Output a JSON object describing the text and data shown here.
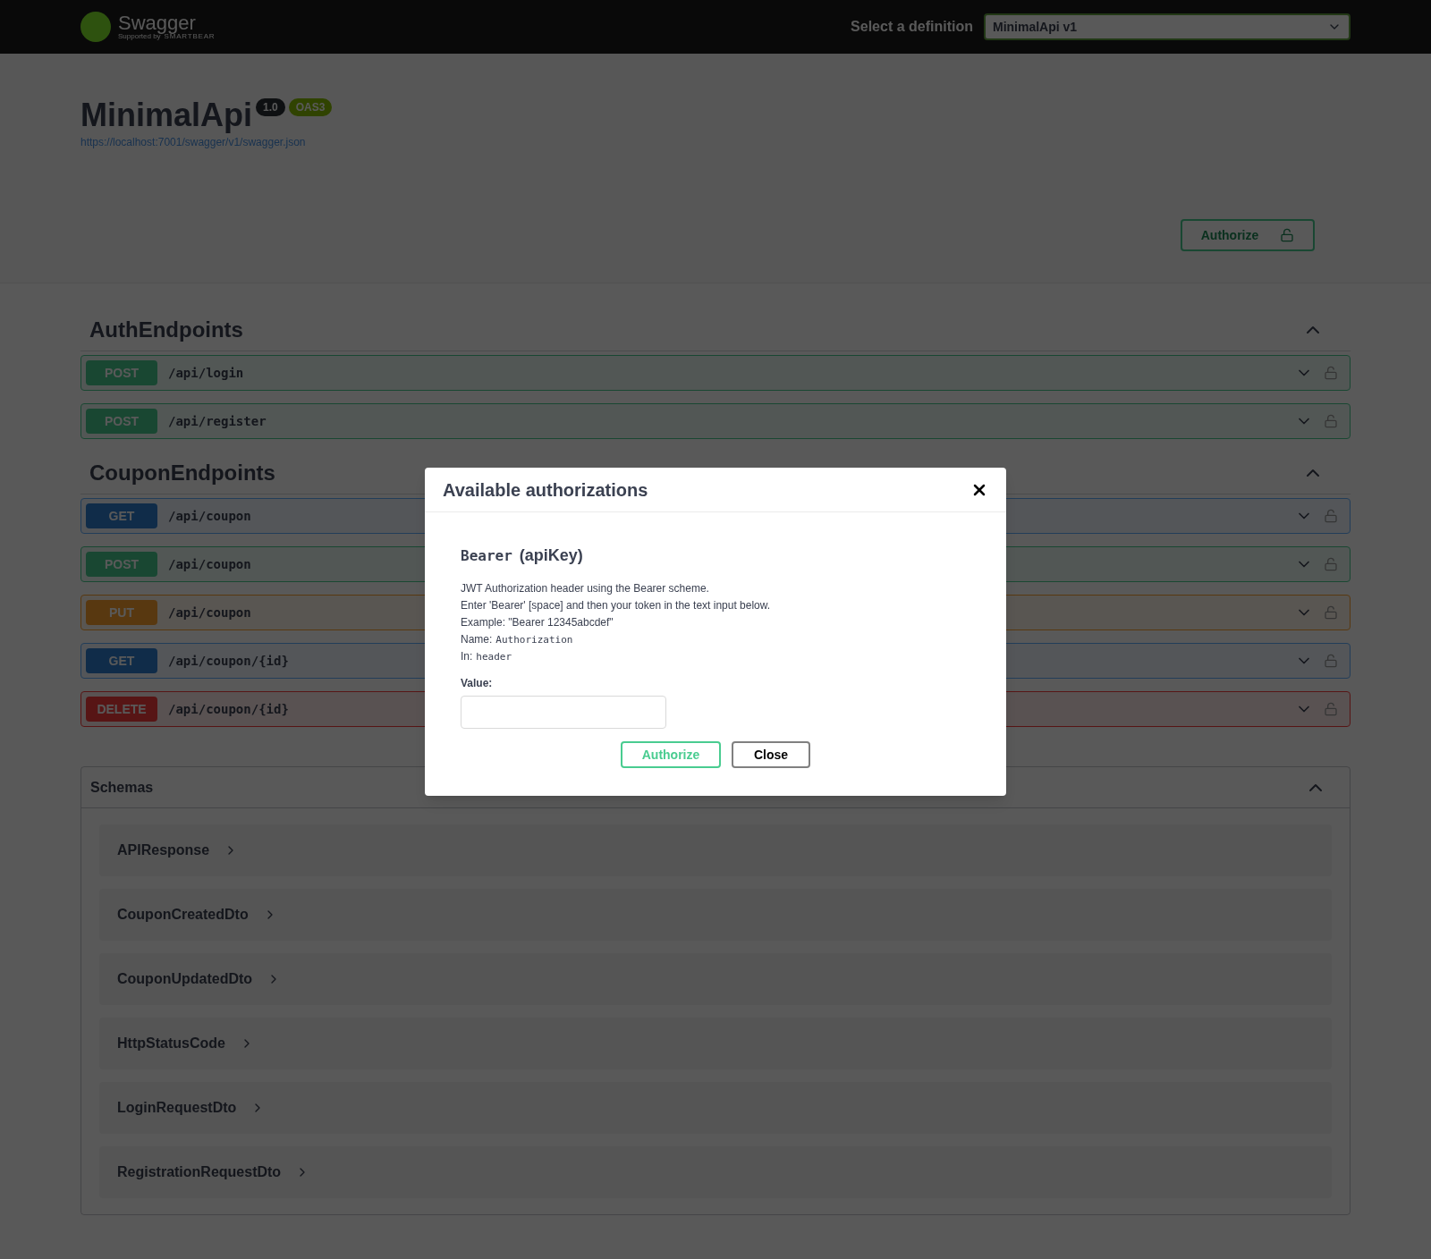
{
  "topbar": {
    "logo_text": "Swagger",
    "logo_supported": "Supported by",
    "logo_company": "SMARTBEAR",
    "definition_label": "Select a definition",
    "definition_value": "MinimalApi v1"
  },
  "info": {
    "title": "MinimalApi",
    "version": "1.0",
    "oas": "OAS3",
    "url": "https://localhost:7001/swagger/v1/swagger.json"
  },
  "authorize_button": {
    "label": "Authorize"
  },
  "sections": [
    {
      "title": "AuthEndpoints",
      "expanded": true,
      "operations": [
        {
          "method": "POST",
          "kind": "post",
          "path": "/api/login"
        },
        {
          "method": "POST",
          "kind": "post",
          "path": "/api/register"
        }
      ]
    },
    {
      "title": "CouponEndpoints",
      "expanded": true,
      "operations": [
        {
          "method": "GET",
          "kind": "get",
          "path": "/api/coupon"
        },
        {
          "method": "POST",
          "kind": "post",
          "path": "/api/coupon"
        },
        {
          "method": "PUT",
          "kind": "put",
          "path": "/api/coupon"
        },
        {
          "method": "GET",
          "kind": "get",
          "path": "/api/coupon/{id}"
        },
        {
          "method": "DELETE",
          "kind": "delete",
          "path": "/api/coupon/{id}"
        }
      ]
    }
  ],
  "schemas": {
    "title": "Schemas",
    "expanded": true,
    "items": [
      "APIResponse",
      "CouponCreatedDto",
      "CouponUpdatedDto",
      "HttpStatusCode",
      "LoginRequestDto",
      "RegistrationRequestDto"
    ]
  },
  "modal": {
    "title": "Available authorizations",
    "scheme_name": "Bearer",
    "scheme_type": "(apiKey)",
    "description": [
      "JWT Authorization header using the Bearer scheme.",
      "Enter 'Bearer' [space] and then your token in the text input below.",
      "Example: \"Bearer 12345abcdef\""
    ],
    "name_label": "Name:",
    "name_value": "Authorization",
    "in_label": "In:",
    "in_value": "header",
    "value_label": "Value:",
    "authorize_label": "Authorize",
    "close_label": "Close"
  }
}
